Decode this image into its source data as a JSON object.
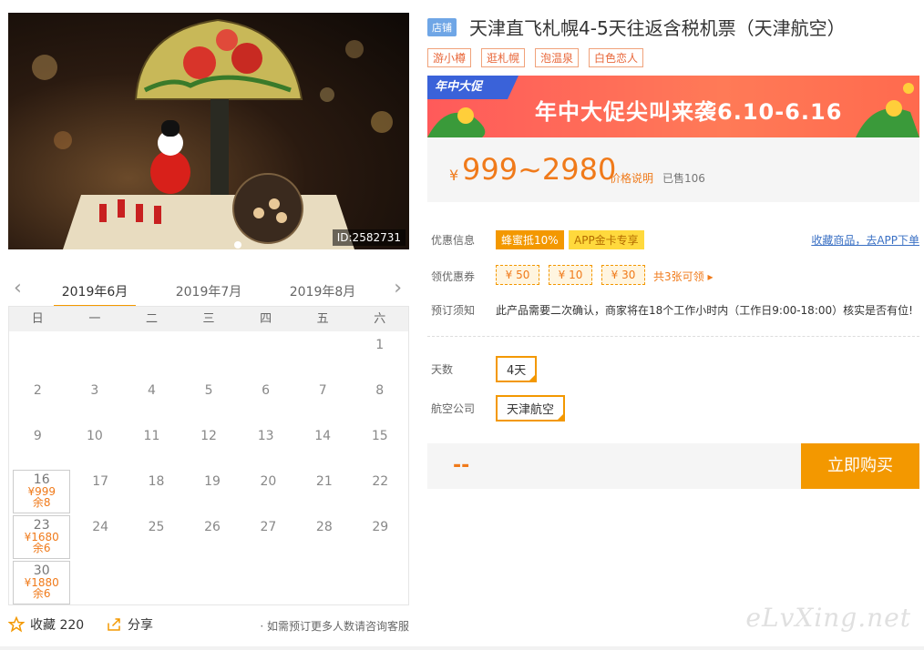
{
  "hero": {
    "image_id": "ID:2582731"
  },
  "calendar": {
    "months": [
      "2019年6月",
      "2019年7月",
      "2019年8月"
    ],
    "weekdays": [
      "日",
      "一",
      "二",
      "三",
      "四",
      "五",
      "六"
    ],
    "rows": [
      [
        {
          "d": ""
        },
        {
          "d": ""
        },
        {
          "d": ""
        },
        {
          "d": ""
        },
        {
          "d": ""
        },
        {
          "d": ""
        },
        {
          "d": "1"
        }
      ],
      [
        {
          "d": "2"
        },
        {
          "d": "3"
        },
        {
          "d": "4"
        },
        {
          "d": "5"
        },
        {
          "d": "6"
        },
        {
          "d": "7"
        },
        {
          "d": "8"
        }
      ],
      [
        {
          "d": "9"
        },
        {
          "d": "10"
        },
        {
          "d": "11"
        },
        {
          "d": "12"
        },
        {
          "d": "13"
        },
        {
          "d": "14"
        },
        {
          "d": "15"
        }
      ],
      [
        {
          "d": "16",
          "price": "¥999",
          "stock": "余8"
        },
        {
          "d": "17"
        },
        {
          "d": "18"
        },
        {
          "d": "19"
        },
        {
          "d": "20"
        },
        {
          "d": "21"
        },
        {
          "d": "22"
        }
      ],
      [
        {
          "d": "23",
          "price": "¥1680",
          "stock": "余6"
        },
        {
          "d": "24"
        },
        {
          "d": "25"
        },
        {
          "d": "26"
        },
        {
          "d": "27"
        },
        {
          "d": "28"
        },
        {
          "d": "29"
        }
      ],
      [
        {
          "d": "30",
          "price": "¥1880",
          "stock": "余6"
        },
        {
          "d": ""
        },
        {
          "d": ""
        },
        {
          "d": ""
        },
        {
          "d": ""
        },
        {
          "d": ""
        },
        {
          "d": ""
        }
      ]
    ]
  },
  "bottom": {
    "fav_label": "收藏 220",
    "share_label": "分享",
    "hint": "· 如需预订更多人数请咨询客服"
  },
  "product": {
    "shop_tag": "店铺",
    "title": "天津直飞札幌4-5天往返含税机票（天津航空）",
    "tags": [
      "游小樽",
      "逛札幌",
      "泡温泉",
      "白色恋人"
    ],
    "banner_badge": "年中大促",
    "banner_text": "年中大促尖叫来袭6.10-6.16",
    "price_symbol": "¥",
    "price": "999~2980",
    "price_note": "价格说明",
    "sold": "已售106"
  },
  "offers": {
    "discount_label": "优惠信息",
    "badge1": "蜂蜜抵10%",
    "badge2": "APP金卡专享",
    "fav_link": "收藏商品，去APP下单",
    "coupon_label": "领优惠券",
    "coupons": [
      "¥ 50",
      "¥ 10",
      "¥ 30"
    ],
    "coupon_more": "共3张可领 ▸",
    "notice_label": "预订须知",
    "notice": "此产品需要二次确认，商家将在18个工作小时内（工作日9:00-18:00）核实是否有位!"
  },
  "options": {
    "days_label": "天数",
    "days_value": "4天",
    "airline_label": "航空公司",
    "airline_value": "天津航空"
  },
  "buy": {
    "placeholder": "--",
    "button": "立即购买"
  },
  "watermark": "eLvXing.net",
  "colors": {
    "accent": "#f39800",
    "price": "#f07a1a",
    "link": "#3a70c4",
    "banner": "#ff5a5a"
  }
}
